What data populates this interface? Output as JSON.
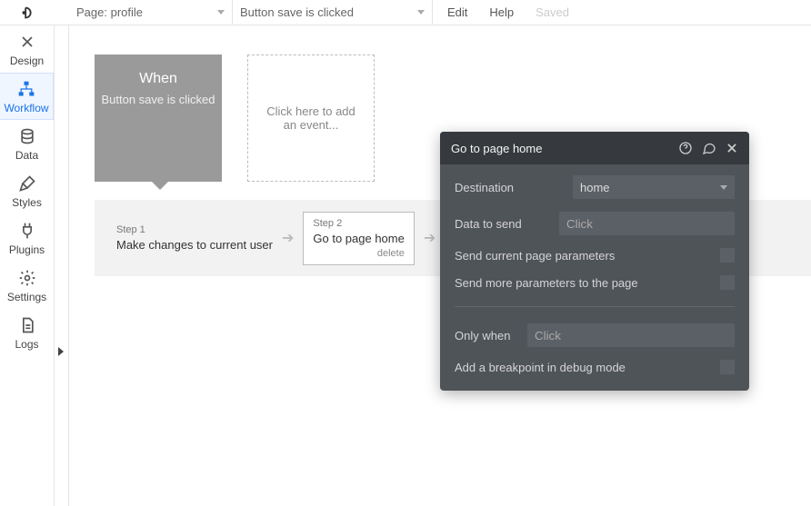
{
  "topbar": {
    "page_dd": "Page: profile",
    "event_dd": "Button save is clicked",
    "menu": {
      "edit": "Edit",
      "help": "Help",
      "saved": "Saved"
    }
  },
  "rail": {
    "design": "Design",
    "workflow": "Workflow",
    "data": "Data",
    "styles": "Styles",
    "plugins": "Plugins",
    "settings": "Settings",
    "logs": "Logs"
  },
  "event": {
    "when": "When",
    "desc": "Button save is clicked"
  },
  "addEvent": "Click here to add an event...",
  "steps": {
    "s1": {
      "label": "Step 1",
      "title": "Make changes to current user"
    },
    "s2": {
      "label": "Step 2",
      "title": "Go to page home",
      "delete": "delete"
    }
  },
  "panel": {
    "title": "Go to page home",
    "destination": {
      "label": "Destination",
      "value": "home"
    },
    "dataToSend": {
      "label": "Data to send",
      "placeholder": "Click"
    },
    "sendCurrent": "Send current page parameters",
    "sendMore": "Send more parameters to the page",
    "onlyWhen": {
      "label": "Only when",
      "placeholder": "Click"
    },
    "breakpoint": "Add a breakpoint in debug mode"
  }
}
